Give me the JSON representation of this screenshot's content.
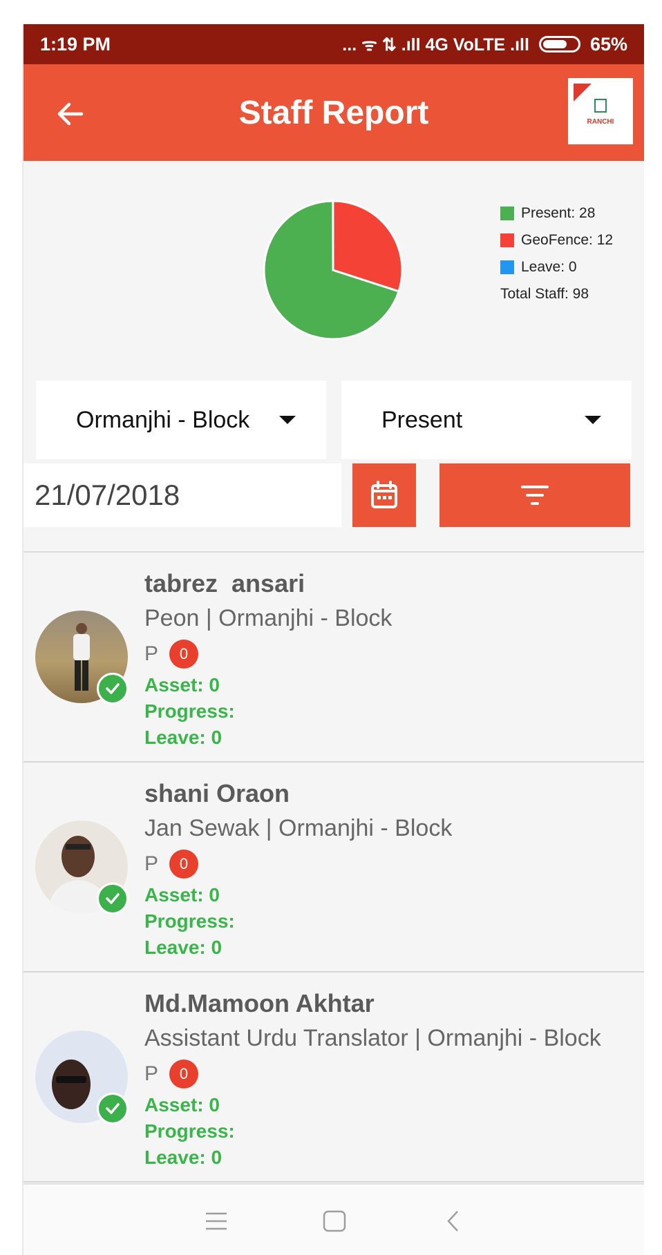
{
  "status_bar": {
    "time": "1:19 PM",
    "signal": "... ᯤ ⇅ .ıll 4G VoLTE .ıll",
    "battery": "65%"
  },
  "app_bar": {
    "title": "Staff Report",
    "logo_text": "RANCHI"
  },
  "chart_data": {
    "type": "pie",
    "categories": [
      "Present",
      "GeoFence",
      "Leave"
    ],
    "values": [
      28,
      12,
      0
    ],
    "colors": [
      "#4caf50",
      "#f44336",
      "#2196f3"
    ],
    "legend": [
      "Present: 28",
      "GeoFence: 12",
      "Leave: 0"
    ],
    "total_label": "Total Staff: 98",
    "legend_position": "right"
  },
  "filters": {
    "block": "Ormanjhi - Block",
    "status": "Present",
    "date": "21/07/2018"
  },
  "staff": [
    {
      "name": "tabrez  ansari",
      "designation": "Peon | Ormanjhi - Block",
      "status": "P",
      "count": "0",
      "asset": "Asset: 0",
      "progress": "Progress:",
      "leave": "Leave: 0"
    },
    {
      "name": "shani Oraon",
      "designation": "Jan Sewak | Ormanjhi - Block",
      "status": "P",
      "count": "0",
      "asset": "Asset: 0",
      "progress": "Progress:",
      "leave": "Leave: 0"
    },
    {
      "name": "Md.Mamoon Akhtar",
      "designation": "Assistant Urdu Translator | Ormanjhi - Block",
      "status": "P",
      "count": "0",
      "asset": "Asset: 0",
      "progress": "Progress:",
      "leave": "Leave: 0"
    }
  ],
  "icons": {
    "back": "arrow-left-icon",
    "calendar": "calendar-icon",
    "filter": "filter-icon",
    "nav_menu": "menu-icon",
    "nav_home": "home-icon",
    "nav_back": "back-icon"
  },
  "colors": {
    "status_bar": "#8e1a0e",
    "accent": "#ec5438",
    "present": "#4caf50",
    "geofence": "#f44336",
    "leave": "#2196f3"
  }
}
